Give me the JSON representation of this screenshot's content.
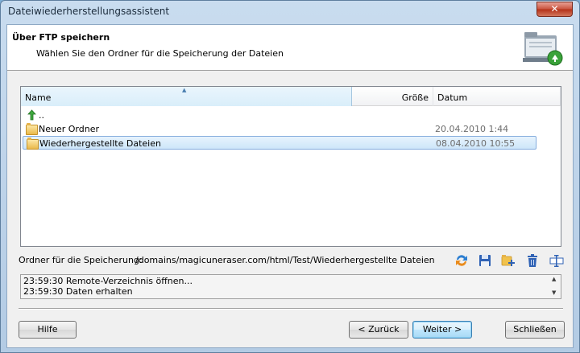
{
  "window": {
    "title": "Dateiwiederherstellungsassistent",
    "close_label": "✕"
  },
  "header": {
    "title": "Über FTP speichern",
    "subtitle": "Wählen Sie den Ordner für die Speicherung der Dateien"
  },
  "list": {
    "columns": {
      "name": "Name",
      "size": "Größe",
      "date": "Datum"
    },
    "rows": [
      {
        "name": "..",
        "date": "",
        "icon": "up-arrow-icon"
      },
      {
        "name": "Neuer Ordner",
        "date": "20.04.2010 1:44",
        "icon": "folder-icon"
      },
      {
        "name": "Wiederhergestellte Dateien",
        "date": "08.04.2010 10:55",
        "icon": "folder-icon",
        "selected": true
      }
    ]
  },
  "path": {
    "label": "Ordner für die Speicherung:",
    "value": "/domains/magicuneraser.com/html/Test/Wiederhergestellte Dateien"
  },
  "toolbar": [
    "refresh-icon",
    "save-icon",
    "new-folder-icon",
    "delete-icon",
    "rename-icon"
  ],
  "log": {
    "lines": [
      "23:59:30 Remote-Verzeichnis öffnen...",
      "23:59:30 Daten erhalten"
    ]
  },
  "buttons": {
    "help": "Hilfe",
    "back": "< Zurück",
    "next": "Weiter >",
    "close": "Schließen"
  },
  "colors": {
    "accent": "#3c7fb1",
    "selection": "#cde6f9",
    "close": "#c9523c"
  }
}
